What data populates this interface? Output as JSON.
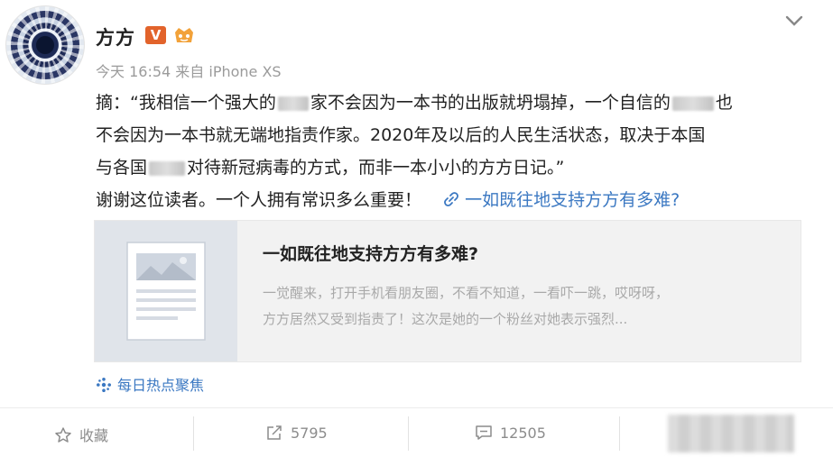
{
  "post": {
    "author": "方方",
    "verified_badge": "V",
    "meta": "今天 16:54 来自 iPhone XS",
    "lines": {
      "l1_a": "摘：“我相信一个强大的",
      "l1_b": "家不会因为一本书的出版就坍塌掉，一个自信的",
      "l1_c": "也",
      "l2": "不会因为一本书就无端地指责作家。2020年及以后的人民生活状态，取决于本国",
      "l3_a": "与各国",
      "l3_b": "对待新冠病毒的方式，而非一本小小的方方日记。”",
      "l4": "谢谢这位读者。一个人拥有常识多么重要！",
      "topic_link": "一如既往地支持方方有多难?"
    }
  },
  "card": {
    "title": "一如既往地支持方方有多难?",
    "desc_line1": "一觉醒来，打开手机看朋友圈，不看不知道，一看吓一跳，哎呀呀，",
    "desc_line2": "方方居然又受到指责了！这次是她的一个粉丝对她表示强烈..."
  },
  "source": {
    "label": "每日热点聚焦"
  },
  "actions": {
    "favorite": "收藏",
    "repost": "5795",
    "comment": "12505"
  },
  "colors": {
    "link": "#3b78c2",
    "badge": "#e2632b",
    "muted": "#9b9b9b"
  },
  "icons": [
    "chevron-down-icon",
    "link-icon",
    "source-icon",
    "star-icon",
    "repost-icon",
    "comment-icon",
    "member-icon"
  ]
}
